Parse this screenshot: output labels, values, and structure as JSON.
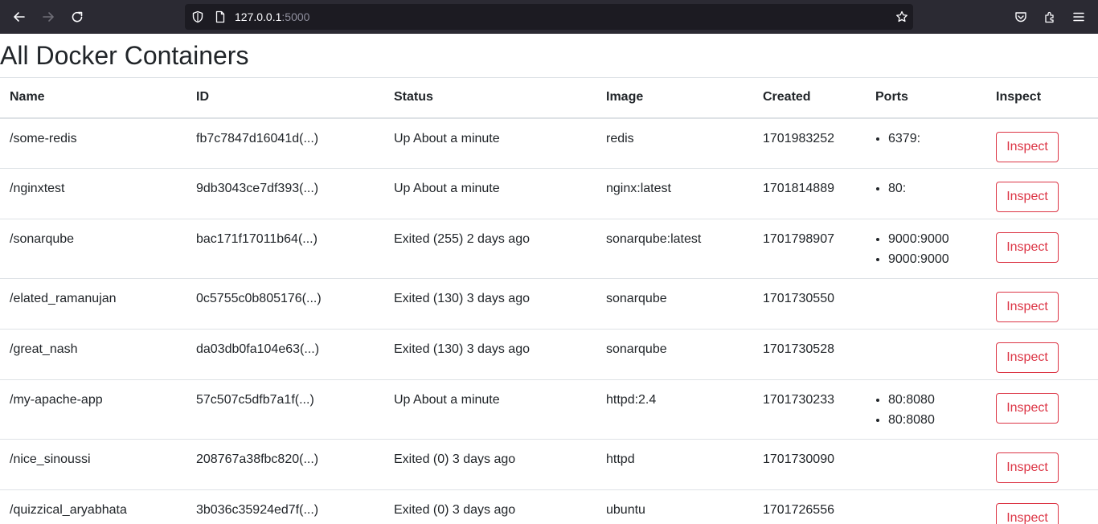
{
  "browser": {
    "url_host": "127.0.0.1",
    "url_port": ":5000"
  },
  "page": {
    "title": "All Docker Containers"
  },
  "table": {
    "headers": {
      "name": "Name",
      "id": "ID",
      "status": "Status",
      "image": "Image",
      "created": "Created",
      "ports": "Ports",
      "inspect": "Inspect"
    },
    "inspect_label": "Inspect",
    "rows": [
      {
        "name": "/some-redis",
        "id": "fb7c7847d16041d(...)",
        "status": "Up About a minute",
        "image": "redis",
        "created": "1701983252",
        "ports": [
          "6379:"
        ]
      },
      {
        "name": "/nginxtest",
        "id": "9db3043ce7df393(...)",
        "status": "Up About a minute",
        "image": "nginx:latest",
        "created": "1701814889",
        "ports": [
          "80:"
        ]
      },
      {
        "name": "/sonarqube",
        "id": "bac171f17011b64(...)",
        "status": "Exited (255) 2 days ago",
        "image": "sonarqube:latest",
        "created": "1701798907",
        "ports": [
          "9000:9000",
          "9000:9000"
        ]
      },
      {
        "name": "/elated_ramanujan",
        "id": "0c5755c0b805176(...)",
        "status": "Exited (130) 3 days ago",
        "image": "sonarqube",
        "created": "1701730550",
        "ports": []
      },
      {
        "name": "/great_nash",
        "id": "da03db0fa104e63(...)",
        "status": "Exited (130) 3 days ago",
        "image": "sonarqube",
        "created": "1701730528",
        "ports": []
      },
      {
        "name": "/my-apache-app",
        "id": "57c507c5dfb7a1f(...)",
        "status": "Up About a minute",
        "image": "httpd:2.4",
        "created": "1701730233",
        "ports": [
          "80:8080",
          "80:8080"
        ]
      },
      {
        "name": "/nice_sinoussi",
        "id": "208767a38fbc820(...)",
        "status": "Exited (0) 3 days ago",
        "image": "httpd",
        "created": "1701730090",
        "ports": []
      },
      {
        "name": "/quizzical_aryabhata",
        "id": "3b036c35924ed7f(...)",
        "status": "Exited (0) 3 days ago",
        "image": "ubuntu",
        "created": "1701726556",
        "ports": []
      }
    ]
  },
  "colors": {
    "inspect_accent": "#dc3545",
    "chrome_bg": "#2b2a33",
    "url_bg": "#1c1b22"
  },
  "icons": {
    "back": "arrow-left-icon",
    "forward": "arrow-right-icon",
    "reload": "reload-icon",
    "shield": "shield-icon",
    "page": "page-icon",
    "star": "star-icon",
    "pocket": "pocket-icon",
    "extensions": "extensions-icon",
    "menu": "hamburger-menu-icon"
  }
}
